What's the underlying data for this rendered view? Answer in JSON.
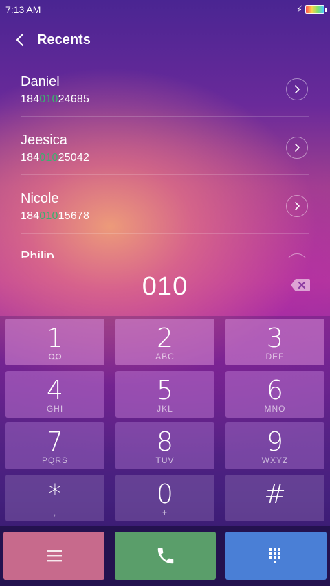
{
  "status_bar": {
    "time": "7:13 AM",
    "charging_icon": "bolt-icon",
    "battery_icon": "battery-icon"
  },
  "header": {
    "title": "Recents",
    "back_icon": "chevron-left-icon"
  },
  "recents": [
    {
      "name": "Daniel",
      "number_prefix": "184",
      "number_match": "010",
      "number_suffix": "24685"
    },
    {
      "name": "Jeesica",
      "number_prefix": "184",
      "number_match": "010",
      "number_suffix": "25042"
    },
    {
      "name": "Nicole",
      "number_prefix": "184",
      "number_match": "010",
      "number_suffix": "15678"
    },
    {
      "name": "Philip",
      "number_prefix": "",
      "number_match": "",
      "number_suffix": ""
    }
  ],
  "dialer": {
    "dialed": "010",
    "backspace_icon": "backspace-icon"
  },
  "keypad": [
    {
      "digit": "1",
      "letters": "",
      "icon": "voicemail-icon"
    },
    {
      "digit": "2",
      "letters": "ABC"
    },
    {
      "digit": "3",
      "letters": "DEF"
    },
    {
      "digit": "4",
      "letters": "GHI"
    },
    {
      "digit": "5",
      "letters": "JKL"
    },
    {
      "digit": "6",
      "letters": "MNO"
    },
    {
      "digit": "7",
      "letters": "PQRS"
    },
    {
      "digit": "8",
      "letters": "TUV"
    },
    {
      "digit": "9",
      "letters": "WXYZ"
    },
    {
      "digit": "*",
      "letters": ","
    },
    {
      "digit": "0",
      "letters": "+"
    },
    {
      "digit": "#",
      "letters": ""
    }
  ],
  "actions": {
    "menu_icon": "menu-icon",
    "call_icon": "phone-icon",
    "keypad_toggle_icon": "dialpad-icon"
  },
  "colors": {
    "match_highlight": "#3bb070",
    "key_light": "#c078c8",
    "key_dark": "#7a4aa0",
    "menu_button": "#c76a8c",
    "call_button": "#5a9e6a",
    "dialpad_button": "#4a7fd6"
  }
}
